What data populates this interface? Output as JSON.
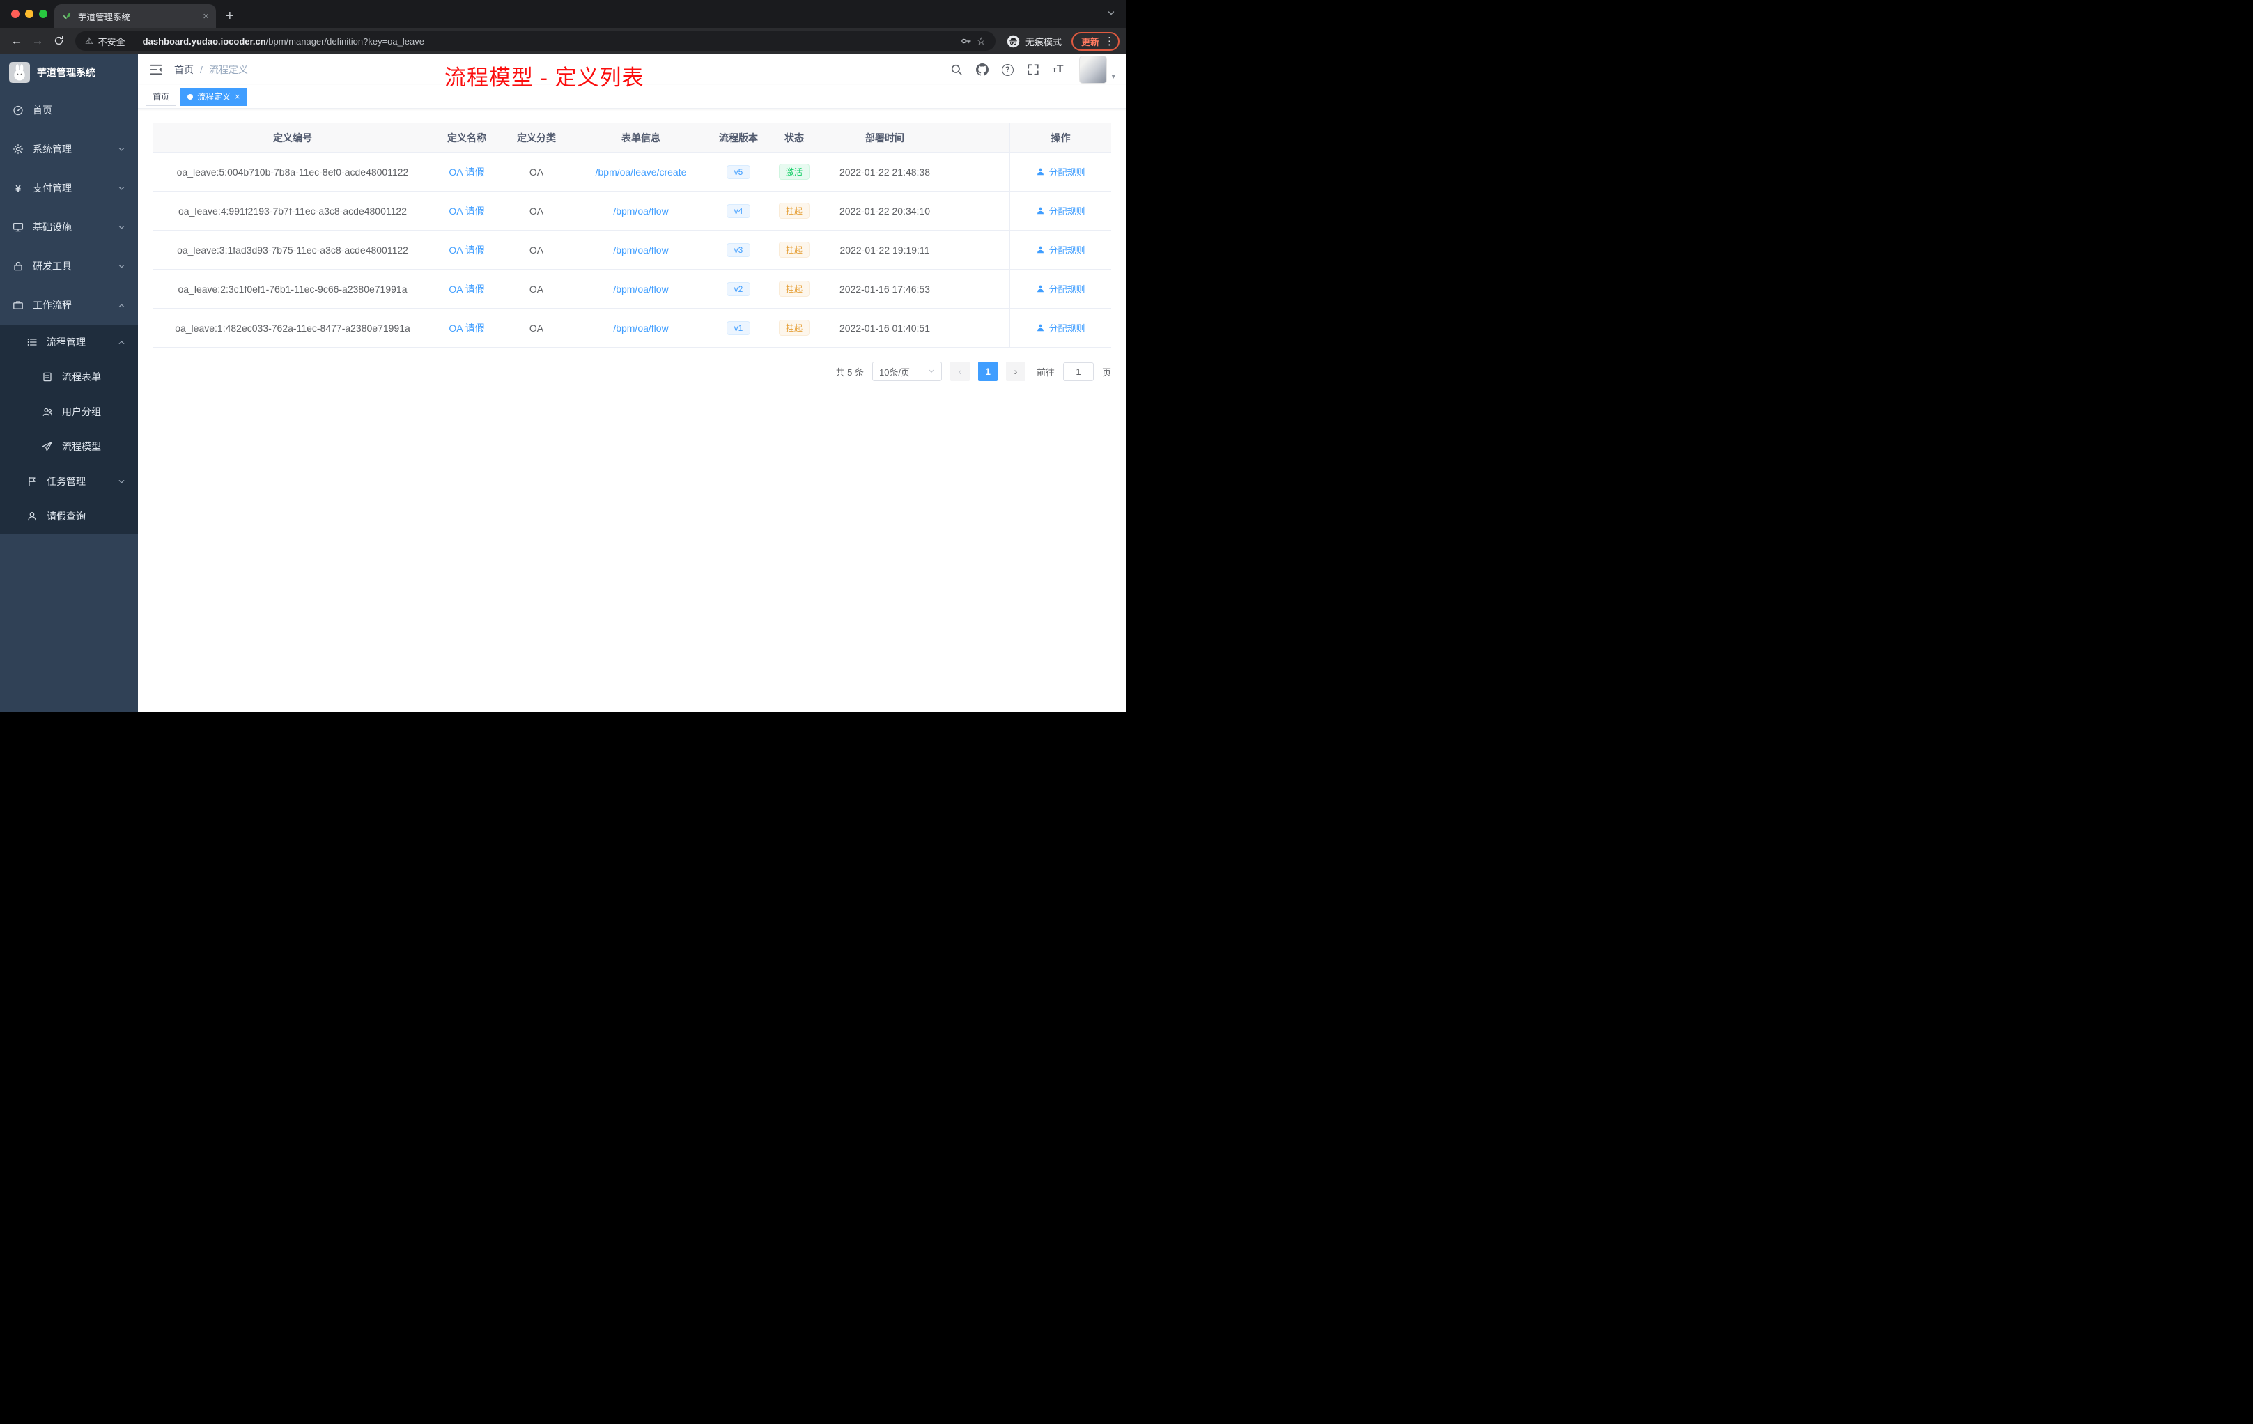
{
  "browser": {
    "tab_title": "芋道管理系统",
    "security_label": "不安全",
    "url_domain": "dashboard.yudao.iocoder.cn",
    "url_path": "/bpm/manager/definition?key=oa_leave",
    "incognito_label": "无痕模式",
    "update_label": "更新"
  },
  "sidebar": {
    "logo_title": "芋道管理系统",
    "items": [
      {
        "label": "首页"
      },
      {
        "label": "系统管理"
      },
      {
        "label": "支付管理"
      },
      {
        "label": "基础设施"
      },
      {
        "label": "研发工具"
      },
      {
        "label": "工作流程"
      }
    ],
    "submenu": {
      "process_management": "流程管理",
      "children": [
        "流程表单",
        "用户分组",
        "流程模型"
      ],
      "task_management": "任务管理",
      "leave_query": "请假查询"
    }
  },
  "header": {
    "breadcrumb": [
      "首页",
      "流程定义"
    ],
    "annotation": "流程模型 - 定义列表"
  },
  "tags": {
    "home": "首页",
    "active": "流程定义"
  },
  "table": {
    "columns": [
      "定义编号",
      "定义名称",
      "定义分类",
      "表单信息",
      "流程版本",
      "状态",
      "部署时间",
      "操作"
    ],
    "rows": [
      {
        "id": "oa_leave:5:004b710b-7b8a-11ec-8ef0-acde48001122",
        "name": "OA 请假",
        "category": "OA",
        "form": "/bpm/oa/leave/create",
        "version": "v5",
        "status": "激活",
        "time": "2022-01-22 21:48:38",
        "action": "分配规则"
      },
      {
        "id": "oa_leave:4:991f2193-7b7f-11ec-a3c8-acde48001122",
        "name": "OA 请假",
        "category": "OA",
        "form": "/bpm/oa/flow",
        "version": "v4",
        "status": "挂起",
        "time": "2022-01-22 20:34:10",
        "action": "分配规则"
      },
      {
        "id": "oa_leave:3:1fad3d93-7b75-11ec-a3c8-acde48001122",
        "name": "OA 请假",
        "category": "OA",
        "form": "/bpm/oa/flow",
        "version": "v3",
        "status": "挂起",
        "time": "2022-01-22 19:19:11",
        "action": "分配规则"
      },
      {
        "id": "oa_leave:2:3c1f0ef1-76b1-11ec-9c66-a2380e71991a",
        "name": "OA 请假",
        "category": "OA",
        "form": "/bpm/oa/flow",
        "version": "v2",
        "status": "挂起",
        "time": "2022-01-16 17:46:53",
        "action": "分配规则"
      },
      {
        "id": "oa_leave:1:482ec033-762a-11ec-8477-a2380e71991a",
        "name": "OA 请假",
        "category": "OA",
        "form": "/bpm/oa/flow",
        "version": "v1",
        "status": "挂起",
        "time": "2022-01-16 01:40:51",
        "action": "分配规则"
      }
    ]
  },
  "pagination": {
    "total": "共 5 条",
    "page_size": "10条/页",
    "current_page": "1",
    "goto_label": "前往",
    "goto_value": "1",
    "page_unit": "页"
  },
  "colors": {
    "accent": "#409eff",
    "success": "#13ce66",
    "warning": "#e6a23c",
    "annotation": "#fb0d0d",
    "sidebar_bg": "#304156",
    "submenu_bg": "#1f2d3d"
  }
}
